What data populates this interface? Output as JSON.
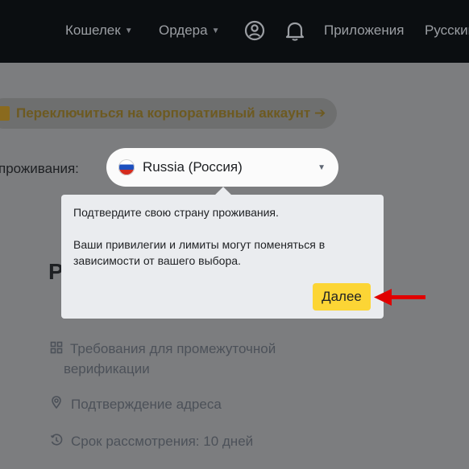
{
  "nav": {
    "wallet": "Кошелек",
    "orders": "Ордера",
    "apps": "Приложения",
    "language": "Русский",
    "icons": [
      "profile-icon",
      "bell-icon"
    ]
  },
  "corporate": {
    "label": "Переключиться на корпоративный аккаунт ➔"
  },
  "residence": {
    "label": "проживания:",
    "country": "Russia (Россия)"
  },
  "heading_fragment": "Р",
  "popover": {
    "line1": "Подтвердите свою страну проживания.",
    "line2": "Ваши привилегии и лимиты могут поменяться в зависимости от вашего выбора.",
    "next_label": "Далее"
  },
  "requirements": [
    {
      "text": "Требования для промежуточной",
      "text2": "верификации",
      "icon": "grid-icon"
    },
    {
      "text": "Подтверждение адреса",
      "icon": "location-pin-icon"
    },
    {
      "text": "Срок рассмотрения: 10 дней",
      "icon": "clock-icon"
    }
  ],
  "colors": {
    "topbar": "#0b0e11",
    "accent": "#fcd535",
    "annotation": "#e00000"
  }
}
